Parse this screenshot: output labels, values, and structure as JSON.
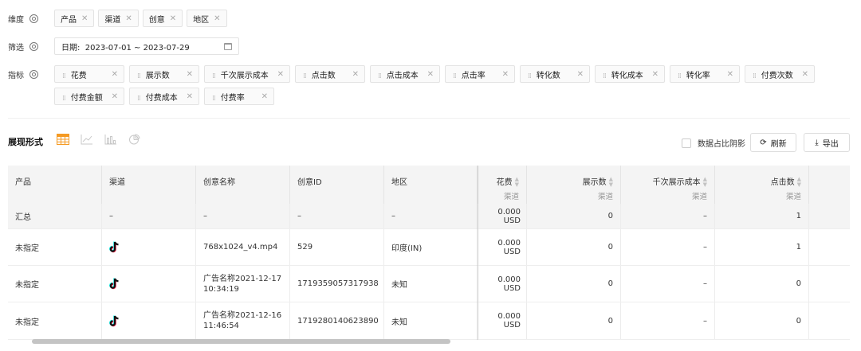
{
  "dimensions": {
    "label": "维度",
    "tags": [
      "产品",
      "渠道",
      "创意",
      "地区"
    ]
  },
  "filter": {
    "label": "筛选",
    "date_label": "日期:",
    "date_value": "2023-07-01 ~ 2023-07-29"
  },
  "metrics": {
    "label": "指标",
    "tags": [
      "花费",
      "展示数",
      "千次展示成本",
      "点击数",
      "点击成本",
      "点击率",
      "转化数",
      "转化成本",
      "转化率",
      "付费次数",
      "付费金额",
      "付费成本",
      "付费率"
    ]
  },
  "view": {
    "title": "展现形式",
    "icons": [
      "table-icon",
      "line-chart-icon",
      "bar-chart-icon",
      "pie-chart-icon"
    ],
    "share_toggle_label": "数据占比阴影",
    "refresh_label": "刷新",
    "export_label": "导出"
  },
  "table": {
    "columns": [
      {
        "label": "产品"
      },
      {
        "label": "渠道"
      },
      {
        "label": "创意名称"
      },
      {
        "label": "创意ID"
      },
      {
        "label": "地区"
      },
      {
        "label": "花费",
        "sub": "渠道"
      },
      {
        "label": "展示数",
        "sub": "渠道"
      },
      {
        "label": "千次展示成本",
        "sub": "渠道"
      },
      {
        "label": "点击数",
        "sub": "渠道"
      }
    ],
    "summary": {
      "product": "汇总",
      "channel": "–",
      "creative": "–",
      "creative_id": "–",
      "region": "–",
      "spend": "0.000 USD",
      "impressions": "0",
      "cpm": "–",
      "clicks": "1"
    },
    "rows": [
      {
        "product": "未指定",
        "channel_icon": "tiktok-icon",
        "creative_1": "768x1024_v4.mp4",
        "creative_2": "",
        "creative_id": "529",
        "region": "印度(IN)",
        "spend": "0.000 USD",
        "impressions": "0",
        "cpm": "–",
        "clicks": "1"
      },
      {
        "product": "未指定",
        "channel_icon": "tiktok-icon",
        "creative_1": "广告名称2021-12-17",
        "creative_2": "10:34:19",
        "creative_id": "1719359057317938",
        "region": "未知",
        "spend": "0.000 USD",
        "impressions": "0",
        "cpm": "–",
        "clicks": "0"
      },
      {
        "product": "未指定",
        "channel_icon": "tiktok-icon",
        "creative_1": "广告名称2021-12-16",
        "creative_2": "11:46:54",
        "creative_id": "1719280140623890",
        "region": "未知",
        "spend": "0.000 USD",
        "impressions": "0",
        "cpm": "–",
        "clicks": "0"
      }
    ]
  },
  "colors": {
    "accent_orange": "#f59a23",
    "icon_gray": "#c8c8c8"
  }
}
